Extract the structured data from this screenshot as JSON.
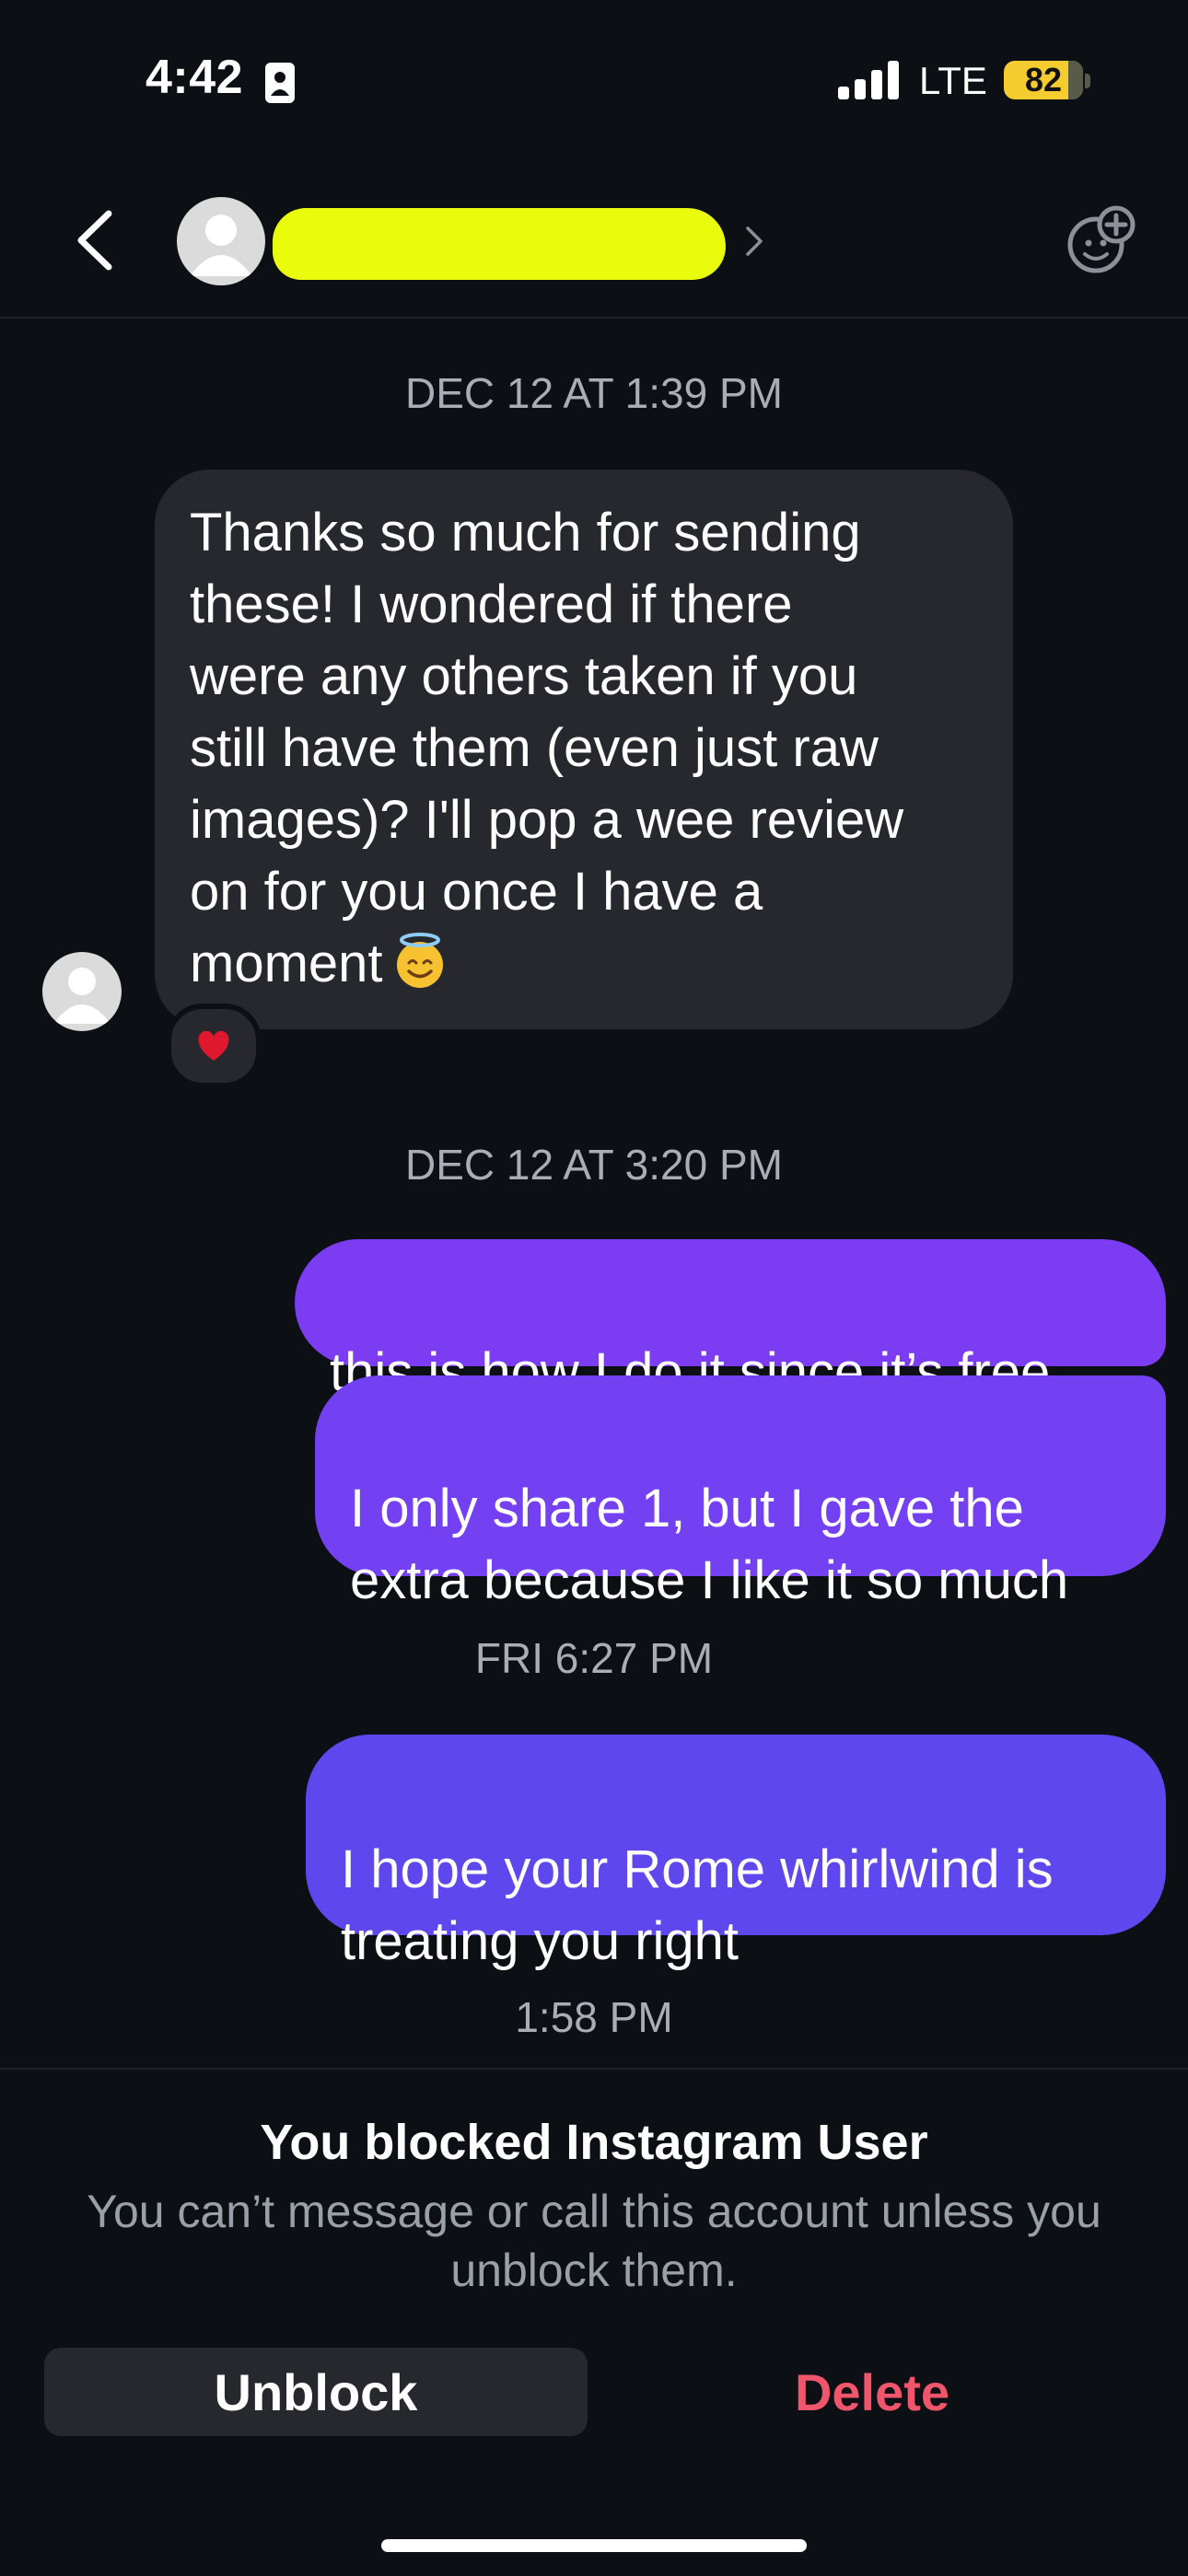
{
  "status_bar": {
    "time": "4:42",
    "network": "LTE",
    "battery": "82",
    "battery_level_percent": 82,
    "battery_color": "#f5cc2f"
  },
  "header": {
    "back_icon": "chevron-left-icon",
    "avatar_icon": "default-avatar-icon",
    "name_redacted_color": "#e9fc0b",
    "action_icon": "sticker-add-icon"
  },
  "messages": [
    {
      "type": "timestamp",
      "text": "DEC 12 AT 1:39 PM"
    },
    {
      "type": "incoming",
      "text": "Thanks so much for sending\nthese! I wondered if there\nwere any others taken if you\nstill have them (even just raw\nimages)? I'll pop a wee review\non for you once I have a\nmoment",
      "emoji": "smiling-face-with-halo",
      "reaction": "red-heart"
    },
    {
      "type": "timestamp",
      "text": "DEC 12 AT 3:20 PM"
    },
    {
      "type": "outgoing",
      "text": "this is how I do it since it’s free."
    },
    {
      "type": "outgoing",
      "text": "I only share 1, but I gave the\nextra because I like it so much"
    },
    {
      "type": "timestamp",
      "text": "FRI 6:27 PM"
    },
    {
      "type": "outgoing",
      "text": "I hope your Rome whirlwind is\ntreating you right"
    },
    {
      "type": "timestamp",
      "text": "1:58 PM"
    }
  ],
  "blocked": {
    "title": "You blocked Instagram User",
    "description": "You can’t message or call this account unless you unblock them.",
    "unblock_label": "Unblock",
    "delete_label": "Delete",
    "delete_color": "#f0566b"
  },
  "colors": {
    "background": "#0c0f14",
    "incoming_bubble": "#26282d",
    "outgoing_bubble_top": "#7b3cf2",
    "outgoing_bubble_bottom": "#5f47ee"
  }
}
